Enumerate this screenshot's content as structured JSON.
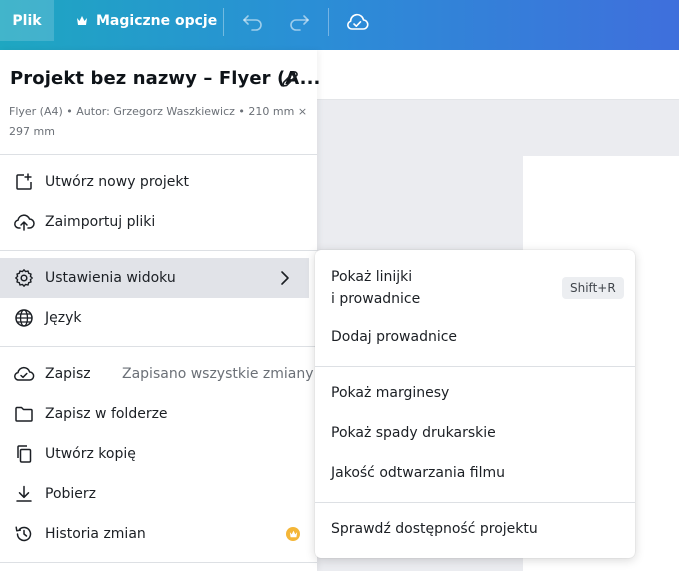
{
  "topbar": {
    "file_label": "Plik",
    "magic_label": "Magiczne opcje",
    "icons": [
      "crown-icon",
      "undo-icon",
      "redo-icon",
      "cloud-check-icon"
    ],
    "gradient": [
      "#1ea7c1",
      "#3f6fdc"
    ]
  },
  "file_panel": {
    "title": "Projekt bez nazwy – Flyer (A...",
    "meta": "Flyer (A4) • Autor: Grzegorz Waszkiewicz • 210 mm × 297 mm",
    "items": [
      {
        "label": "Utwórz nowy projekt",
        "icon": "add-page-icon"
      },
      {
        "label": "Zaimportuj pliki",
        "icon": "cloud-upload-icon"
      },
      {
        "label": "Ustawienia widoku",
        "icon": "gear-icon"
      },
      {
        "label": "Język",
        "icon": "globe-icon"
      },
      {
        "label": "Zapisz",
        "icon": "cloud-check-icon",
        "status": "Zapisano wszystkie zmiany"
      },
      {
        "label": "Zapisz w folderze",
        "icon": "folder-icon"
      },
      {
        "label": "Utwórz kopię",
        "icon": "copy-icon"
      },
      {
        "label": "Pobierz",
        "icon": "download-icon"
      },
      {
        "label": "Historia zmian",
        "icon": "history-icon",
        "badge": "crown-icon"
      }
    ]
  },
  "view_submenu": {
    "items": [
      {
        "label_line1": "Pokaż linijki",
        "label_line2": "i prowadnice",
        "shortcut": "Shift+R"
      },
      {
        "label": "Dodaj prowadnice"
      },
      {
        "label": "Pokaż marginesy"
      },
      {
        "label": "Pokaż spady drukarskie"
      },
      {
        "label": "Jakość odtwarzania filmu"
      },
      {
        "label": "Sprawdź dostępność projektu"
      }
    ]
  },
  "colors": {
    "accent_crown": "#f4b638",
    "active_row": "#e1e3e8"
  }
}
